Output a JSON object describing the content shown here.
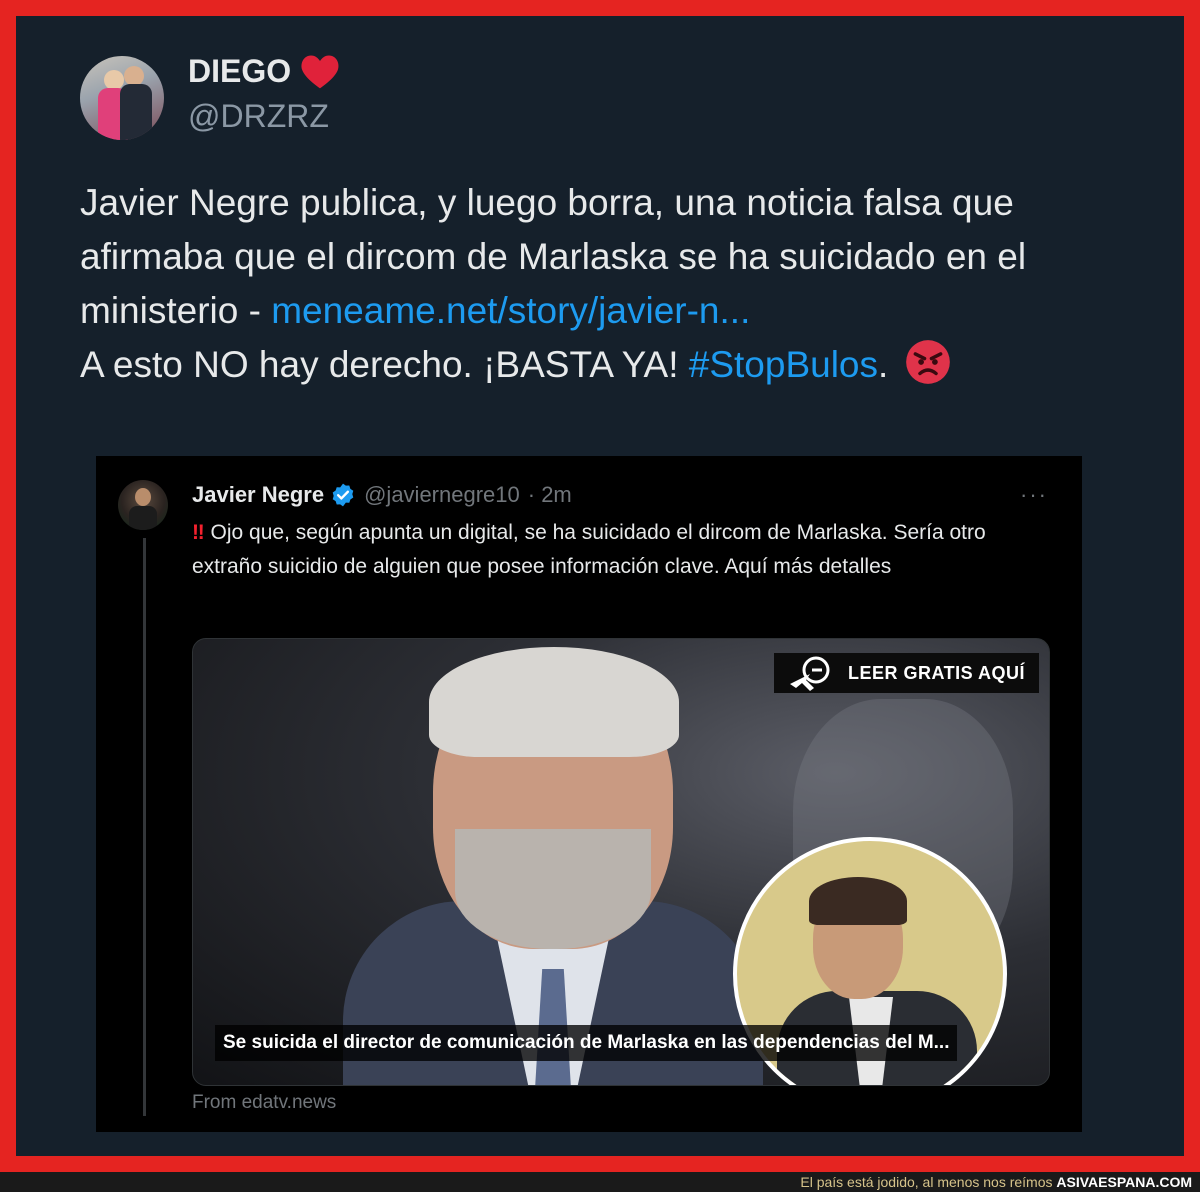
{
  "author": {
    "name": "DIEGO",
    "handle": "@DRZRZ"
  },
  "tweet": {
    "text_line1": "Javier Negre publica, y luego borra, una noticia falsa que afirmaba que el dircom de Marlaska se ha suicidado en el ministerio - ",
    "link": "meneame.net/story/javier-n...",
    "text_line2": "A esto NO hay derecho. ¡BASTA YA! ",
    "hashtag": "#StopBulos",
    "period": "."
  },
  "quoted": {
    "name": "Javier Negre",
    "handle": "@javiernegre10",
    "time": "· 2m",
    "more": "···",
    "alert": "‼",
    "text": "Ojo que, según apunta un digital, se ha suicidado el dircom de Marlaska. Sería otro extraño suicidio de alguien que posee información clave. Aquí más detalles",
    "card": {
      "badge": "LEER GRATIS AQUÍ",
      "caption": "Se suicida el director de comunicación de Marlaska en las dependencias del M...",
      "source": "From edatv.news"
    }
  },
  "footer": {
    "tagline": "El país está jodido, al menos nos reímos ",
    "brand": "ASIVAESPANA.COM"
  },
  "colors": {
    "frame": "#e52421",
    "background": "#15202b",
    "link": "#1d9bf0",
    "text": "#e7e9ea",
    "muted": "#8b98a5"
  },
  "icons": [
    "heart-icon",
    "angry-face-icon",
    "verified-badge-icon",
    "more-options-icon",
    "cursor-arrow-icon"
  ]
}
